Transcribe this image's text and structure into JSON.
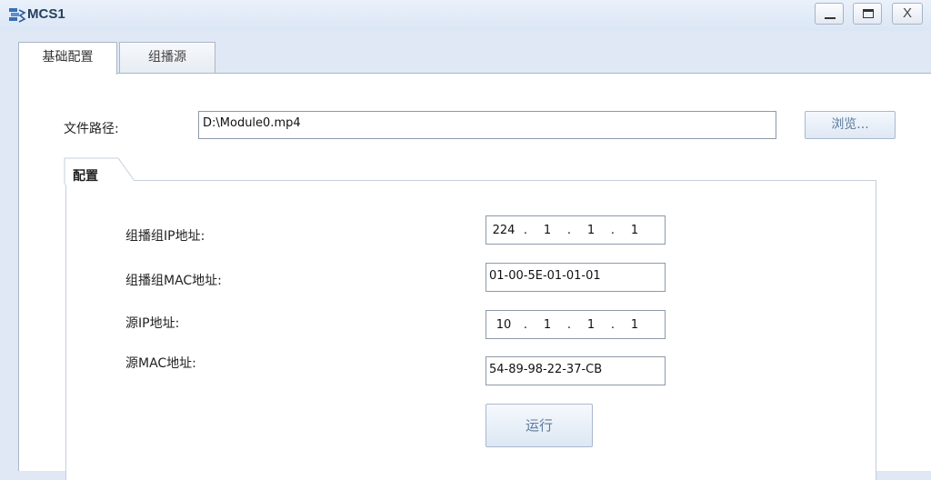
{
  "window": {
    "title": "MCS1",
    "minimize_label": "—",
    "maximize_label": "",
    "close_label": "X"
  },
  "tabs": [
    {
      "label": "基础配置",
      "active": true
    },
    {
      "label": "组播源",
      "active": false
    }
  ],
  "file": {
    "label": "文件路径:",
    "value": "D:\\Module0.mp4",
    "browse_label": "浏览..."
  },
  "config": {
    "title": "配置",
    "group_ip_label": "组播组IP地址:",
    "group_ip": [
      "224",
      "1",
      "1",
      "1"
    ],
    "group_mac_label": "组播组MAC地址:",
    "group_mac": "01-00-5E-01-01-01",
    "src_ip_label": "源IP地址:",
    "src_ip": [
      "10",
      "1",
      "1",
      "1"
    ],
    "src_mac_label": "源MAC地址:",
    "src_mac": "54-89-98-22-37-CB",
    "run_label": "运行"
  },
  "colors": {
    "accent": "#5c7b9e",
    "border": "#aab7c8",
    "titlebar": "#dbe6f5"
  }
}
